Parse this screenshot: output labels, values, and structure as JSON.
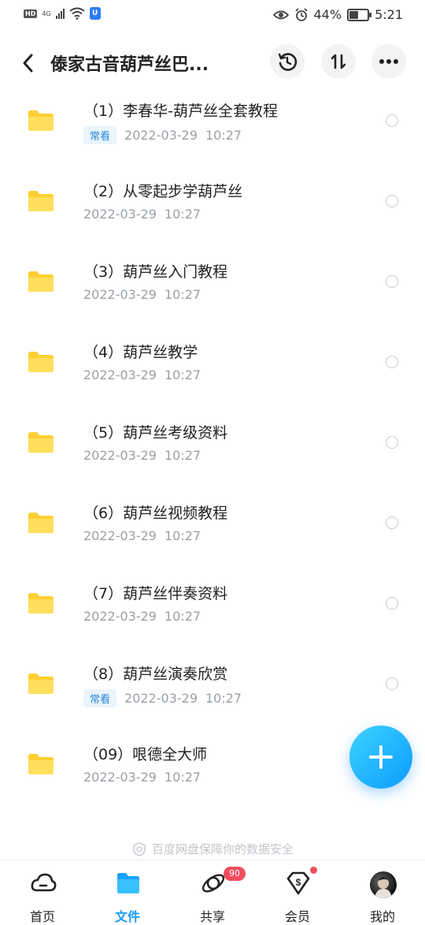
{
  "status_bar": {
    "left_badge": "HD",
    "network": "4G",
    "battery_percent_label": "44%",
    "battery_level": 0.44,
    "time": "5:21"
  },
  "header": {
    "title": "傣家古音葫芦丝巴...",
    "icons": [
      "back-icon",
      "history-icon",
      "sort-icon",
      "more-icon"
    ]
  },
  "folders": [
    {
      "name": "（1）李春华-葫芦丝全套教程",
      "tag": "常看",
      "date": "2022-03-29",
      "time": "10:27"
    },
    {
      "name": "（2）从零起步学葫芦丝",
      "tag": "",
      "date": "2022-03-29",
      "time": "10:27"
    },
    {
      "name": "（3）葫芦丝入门教程",
      "tag": "",
      "date": "2022-03-29",
      "time": "10:27"
    },
    {
      "name": "（4）葫芦丝教学",
      "tag": "",
      "date": "2022-03-29",
      "time": "10:27"
    },
    {
      "name": "（5）葫芦丝考级资料",
      "tag": "",
      "date": "2022-03-29",
      "time": "10:27"
    },
    {
      "name": "（6）葫芦丝视频教程",
      "tag": "",
      "date": "2022-03-29",
      "time": "10:27"
    },
    {
      "name": "（7）葫芦丝伴奏资料",
      "tag": "",
      "date": "2022-03-29",
      "time": "10:27"
    },
    {
      "name": "（8）葫芦丝演奏欣赏",
      "tag": "常看",
      "date": "2022-03-29",
      "time": "10:27"
    },
    {
      "name": "（09）哏德全大师",
      "tag": "",
      "date": "2022-03-29",
      "time": "10:27"
    }
  ],
  "security_notice": "百度网盘保障你的数据安全",
  "tabs": [
    {
      "label": "首页",
      "icon": "cloud-home-icon"
    },
    {
      "label": "文件",
      "icon": "folder-icon",
      "active": true
    },
    {
      "label": "共享",
      "icon": "share-orbit-icon",
      "badge": "90"
    },
    {
      "label": "会员",
      "icon": "vip-diamond-icon"
    },
    {
      "label": "我的",
      "icon": "avatar"
    }
  ],
  "colors": {
    "accent": "#1a9bff",
    "folder": "#ffd84d",
    "badge": "#f04d5d"
  }
}
